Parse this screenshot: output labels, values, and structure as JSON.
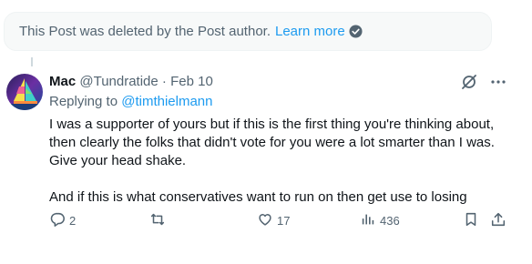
{
  "deleted_notice": {
    "text": "This Post was deleted by the Post author.",
    "learn_more": "Learn more"
  },
  "post": {
    "author_name": "Mac",
    "author_handle": "@Tundratide",
    "separator": "·",
    "date": "Feb 10",
    "replying_label": "Replying to",
    "replying_handle": "@timthielmann",
    "lines": [
      "I was a supporter of yours but if this is the first thing you're thinking about,",
      "then clearly the folks that didn't vote for you were a lot smarter than I was.",
      "Give your head shake.",
      "And if this is what conservatives want to run on then get use to losing"
    ]
  },
  "actions": {
    "reply_count": "2",
    "like_count": "17",
    "views_count": "436"
  },
  "colors": {
    "accent": "#1d9bf0",
    "secondary_text": "#536471",
    "verified_check": "#00ba7c"
  }
}
